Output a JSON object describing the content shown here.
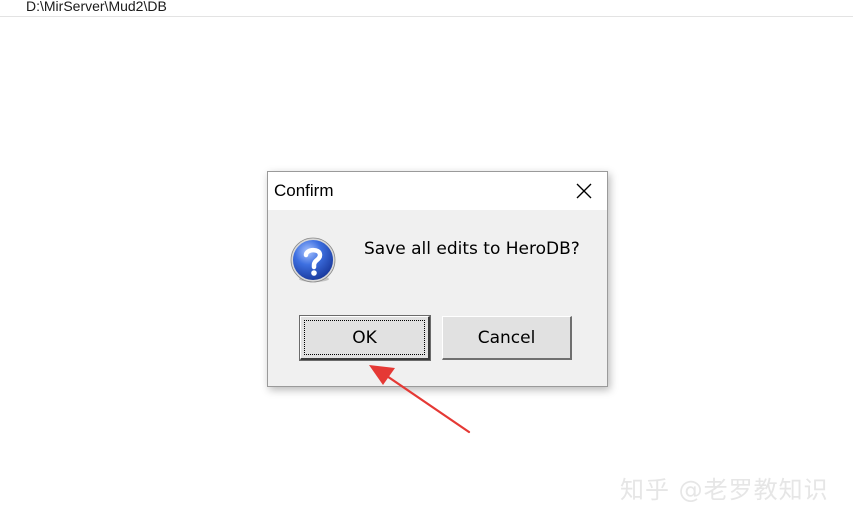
{
  "path_bar": {
    "text": "D:\\MirServer\\Mud2\\DB"
  },
  "dialog": {
    "title": "Confirm",
    "close_icon": "close-icon",
    "message": "Save all edits to HeroDB?",
    "message_icon": "question-icon",
    "ok_label": "OK",
    "cancel_label": "Cancel"
  },
  "annotation": {
    "arrow_color": "#e53935"
  },
  "watermark": {
    "text": "知乎 @老罗教知识"
  }
}
